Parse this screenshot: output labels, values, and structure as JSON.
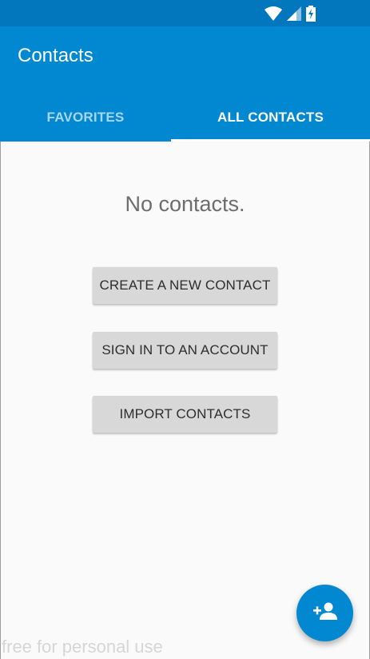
{
  "app": {
    "title": "Contacts"
  },
  "status_bar": {
    "icons": [
      "wifi-icon",
      "cell-signal-icon",
      "battery-charging-icon"
    ]
  },
  "tabs": [
    {
      "label": "FAVORITES",
      "selected": false
    },
    {
      "label": "ALL CONTACTS",
      "selected": true
    }
  ],
  "empty_state": {
    "message": "No contacts."
  },
  "actions": {
    "create_label": "CREATE A NEW CONTACT",
    "signin_label": "SIGN IN TO AN ACCOUNT",
    "import_label": "IMPORT CONTACTS"
  },
  "fab": {
    "icon": "add-person-icon"
  },
  "watermark": "free for personal use",
  "colors": {
    "status_bar": "#0277bd",
    "app_bar": "#0288d1",
    "background": "#fafafa",
    "button": "#d8d8d8"
  }
}
